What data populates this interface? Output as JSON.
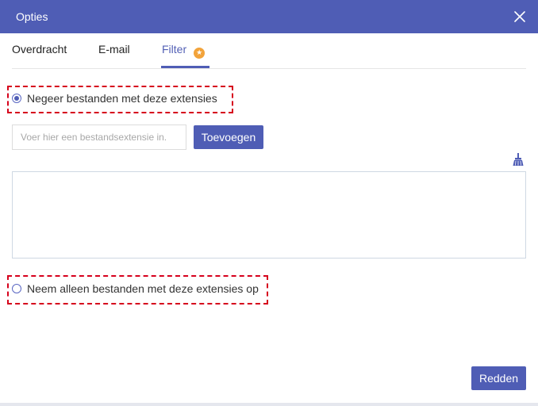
{
  "dialog": {
    "title": "Opties"
  },
  "tabs": [
    {
      "label": "Overdracht",
      "active": false
    },
    {
      "label": "E-mail",
      "active": false
    },
    {
      "label": "Filter",
      "active": true,
      "badge_icon": "star-icon"
    }
  ],
  "filter": {
    "option_ignore": {
      "label": "Negeer bestanden met deze extensies",
      "selected": true
    },
    "extension_input": {
      "value": "",
      "placeholder": "Voer hier een bestandsextensie in."
    },
    "add_button": "Toevoegen",
    "clear_icon": "broom-icon",
    "extension_list": [],
    "option_include": {
      "label": "Neem alleen bestanden met deze extensies op",
      "selected": false
    }
  },
  "footer": {
    "save_button": "Redden"
  },
  "colors": {
    "accent": "#4f5db5",
    "highlight_dash": "#d6001c",
    "badge": "#f2a33a"
  }
}
